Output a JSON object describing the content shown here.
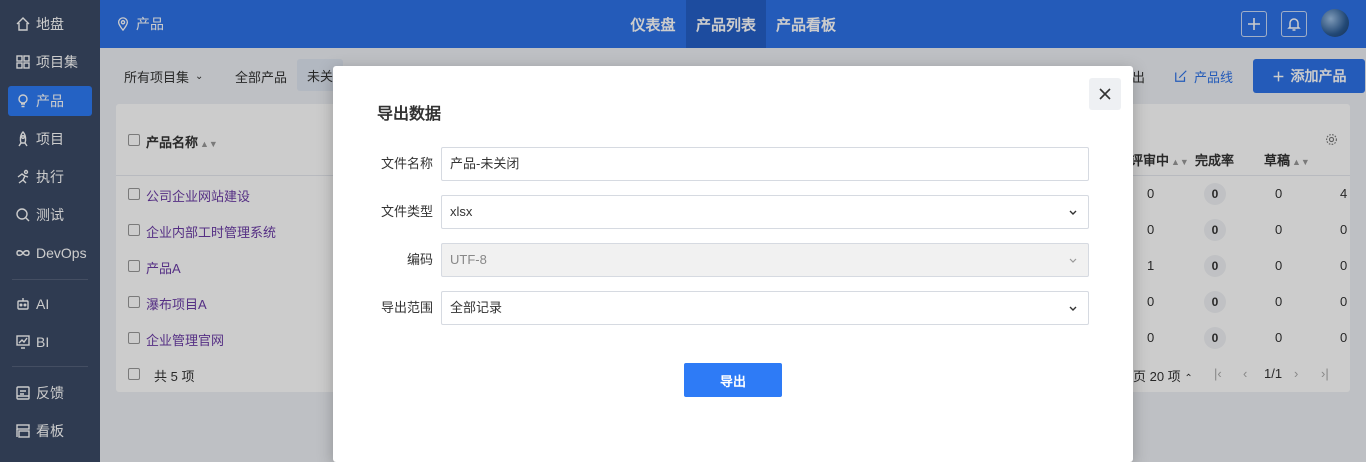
{
  "sidebar": {
    "items": [
      {
        "label": "地盘",
        "icon": "home-icon"
      },
      {
        "label": "项目集",
        "icon": "grid-icon"
      },
      {
        "label": "产品",
        "icon": "lightbulb-icon"
      },
      {
        "label": "项目",
        "icon": "rocket-icon"
      },
      {
        "label": "执行",
        "icon": "run-icon"
      },
      {
        "label": "测试",
        "icon": "bug-search-icon"
      },
      {
        "label": "DevOps",
        "icon": "infinity-icon"
      },
      {
        "label": "AI",
        "icon": "robot-icon"
      },
      {
        "label": "BI",
        "icon": "chart-board-icon"
      },
      {
        "label": "反馈",
        "icon": "feedback-icon"
      },
      {
        "label": "看板",
        "icon": "kanban-icon"
      }
    ],
    "active_index": 2
  },
  "topbar": {
    "breadcrumb": "产品",
    "tabs": [
      "仪表盘",
      "产品列表",
      "产品看板"
    ],
    "active_tab": 1
  },
  "filterbar": {
    "program_select": "所有项目集",
    "all_products": "全部产品",
    "unclosed_chip": "未关",
    "export_partial": "出",
    "product_line": "产品线",
    "add_product": "添加产品"
  },
  "table": {
    "headers": {
      "name": "产品名称",
      "reviewing": "评审中",
      "completion": "完成率",
      "draft": "草稿"
    },
    "rows": [
      {
        "name": "公司企业网站建设",
        "reviewing": "0",
        "completion": "0",
        "draft": "0",
        "last": "4"
      },
      {
        "name": "企业内部工时管理系统",
        "reviewing": "0",
        "completion": "0",
        "draft": "0",
        "last": "0"
      },
      {
        "name": "产品A",
        "reviewing": "1",
        "completion": "0",
        "draft": "0",
        "last": "0"
      },
      {
        "name": "瀑布项目A",
        "reviewing": "0",
        "completion": "0",
        "draft": "0",
        "last": "0"
      },
      {
        "name": "企业管理官网",
        "reviewing": "0",
        "completion": "0",
        "draft": "0",
        "last": "0"
      }
    ],
    "footer": {
      "total": "共 5 项",
      "per_page": "页 20 项",
      "page": "1/1"
    }
  },
  "modal": {
    "title": "导出数据",
    "fields": {
      "filename_label": "文件名称",
      "filename_value": "产品-未关闭",
      "filetype_label": "文件类型",
      "filetype_value": "xlsx",
      "encoding_label": "编码",
      "encoding_value": "UTF-8",
      "range_label": "导出范围",
      "range_value": "全部记录"
    },
    "export_button": "导出"
  },
  "colors": {
    "sidebar_bg": "#3b4a66",
    "topbar_bg": "#2e72e8",
    "accent": "#2e7bf6"
  }
}
